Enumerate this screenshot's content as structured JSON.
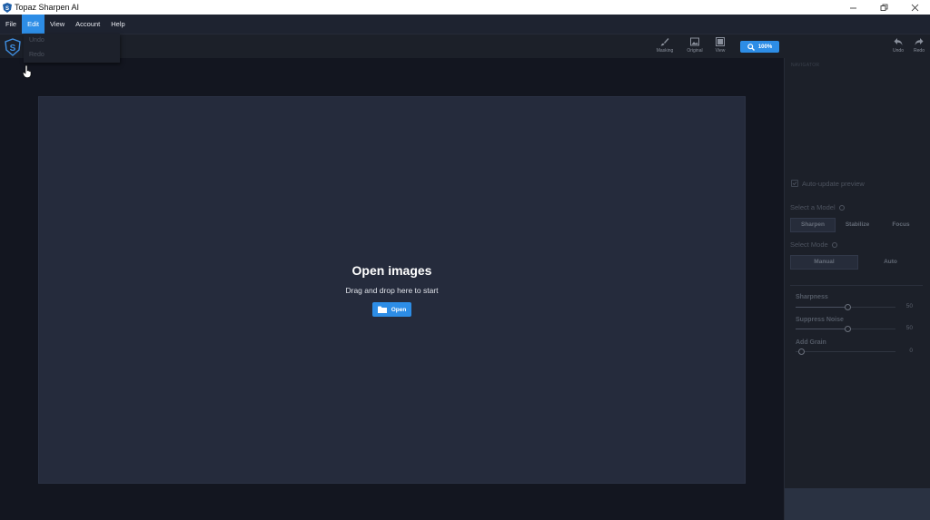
{
  "window": {
    "title": "Topaz Sharpen AI",
    "controls": [
      "minimize",
      "restore",
      "close"
    ]
  },
  "menu": {
    "items": [
      {
        "label": "File",
        "active": false
      },
      {
        "label": "Edit",
        "active": true
      },
      {
        "label": "View",
        "active": false
      },
      {
        "label": "Account",
        "active": false
      },
      {
        "label": "Help",
        "active": false
      }
    ],
    "edit_dropdown": [
      "Undo",
      "Redo"
    ]
  },
  "toolbar": {
    "masking": "Masking",
    "original": "Original",
    "view": "View",
    "zoom": "100%",
    "undo": "Undo",
    "redo": "Redo"
  },
  "main": {
    "title": "Open images",
    "subtitle": "Drag and drop here to start",
    "open_button": "Open"
  },
  "side_panel": {
    "navigator_label": "NAVIGATOR",
    "auto_update": {
      "label": "Auto-update preview",
      "checked": true
    },
    "model": {
      "label": "Select a Model",
      "options": [
        "Sharpen",
        "Stabilize",
        "Focus"
      ],
      "selected": "Sharpen"
    },
    "mode": {
      "label": "Select Mode",
      "options": [
        "Manual",
        "Auto"
      ],
      "selected": "Manual"
    },
    "sliders": [
      {
        "label": "Sharpness",
        "value": "50",
        "fraction": 0.5
      },
      {
        "label": "Suppress Noise",
        "value": "50",
        "fraction": 0.5
      },
      {
        "label": "Add Grain",
        "value": "0",
        "fraction": 0.0
      }
    ]
  },
  "colors": {
    "accent": "#2d8de6",
    "background": "#131620",
    "panel": "#252b3c",
    "sidebar": "#1c2029"
  },
  "icons": [
    "topaz-s-logo",
    "brush-icon",
    "image-icon",
    "view-icon",
    "zoom-magnifier-icon",
    "undo-arrow-icon",
    "redo-arrow-icon",
    "folder-icon",
    "checkbox-icon",
    "info-icon",
    "hand-cursor"
  ]
}
